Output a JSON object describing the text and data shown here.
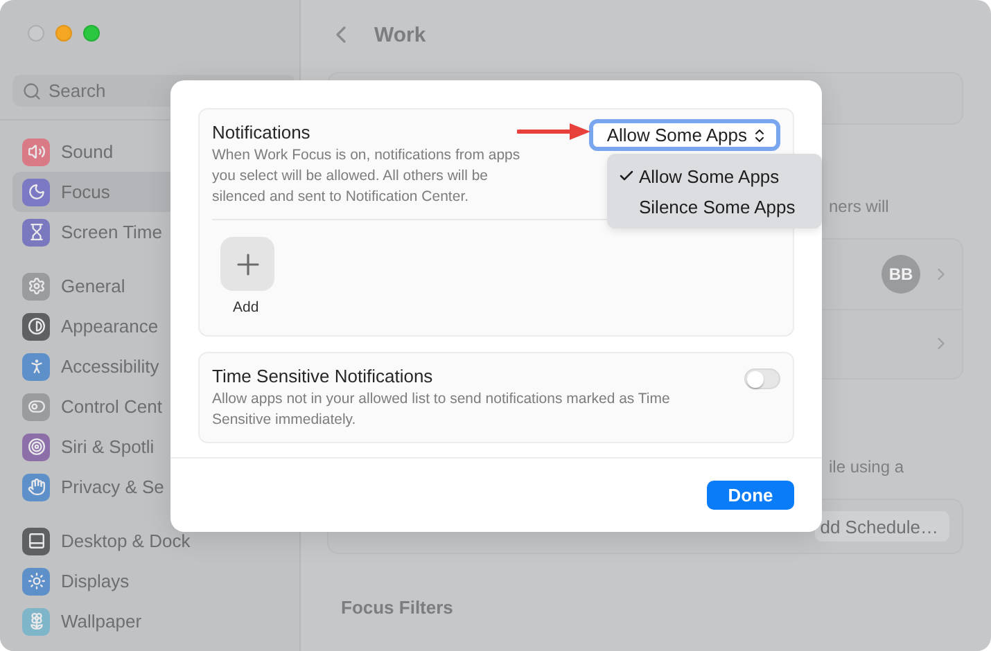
{
  "sidebar": {
    "search": {
      "placeholder": "Search"
    },
    "groups": [
      [
        {
          "label": "Sound",
          "selected": false
        },
        {
          "label": "Focus",
          "selected": true
        },
        {
          "label": "Screen Time",
          "selected": false
        }
      ],
      [
        {
          "label": "General",
          "selected": false
        },
        {
          "label": "Appearance",
          "selected": false
        },
        {
          "label": "Accessibility",
          "selected": false
        },
        {
          "label": "Control Cent",
          "selected": false
        },
        {
          "label": "Siri & Spotli",
          "selected": false
        },
        {
          "label": "Privacy & Se",
          "selected": false
        }
      ],
      [
        {
          "label": "Desktop & Dock",
          "selected": false
        },
        {
          "label": "Displays",
          "selected": false
        },
        {
          "label": "Wallpaper",
          "selected": false
        }
      ]
    ]
  },
  "page": {
    "title": "Work",
    "text_1": "ners will",
    "avatar": "BB",
    "text_2": "ile using a",
    "schedule_button": "dd Schedule…",
    "section_title": "Focus Filters"
  },
  "modal": {
    "notifications": {
      "title": "Notifications",
      "description": "When Work Focus is on, notifications from apps you select will be allowed. All others will be silenced and sent to Notification Center.",
      "popup": {
        "value": "Allow Some Apps",
        "options": [
          {
            "label": "Allow Some Apps",
            "selected": true
          },
          {
            "label": "Silence Some Apps",
            "selected": false
          }
        ]
      },
      "add_label": "Add"
    },
    "time_sensitive": {
      "title": "Time Sensitive Notifications",
      "description": "Allow apps not in your allowed list to send notifications marked as Time Sensitive immediately.",
      "on": false
    },
    "done": "Done"
  }
}
